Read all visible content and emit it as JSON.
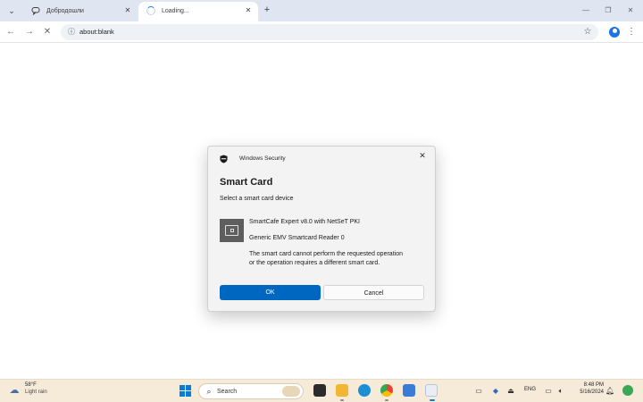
{
  "browser": {
    "tab_search_icon": "chevron-down-icon",
    "tabs": [
      {
        "title": "Добродошли",
        "icon": "chat-icon",
        "close_icon": "close-icon"
      },
      {
        "title": "Loading...",
        "icon": "spinner-icon",
        "close_icon": "close-icon"
      }
    ],
    "new_tab_icon": "plus-icon",
    "window_controls": [
      "minimize-icon",
      "restore-icon",
      "close-icon"
    ],
    "address": "about:blank",
    "nav_icons": [
      "back-icon",
      "forward-icon",
      "stop-icon"
    ]
  },
  "dialog": {
    "app_title": "Windows Security",
    "heading": "Smart Card",
    "subtitle": "Select a smart card device",
    "device_name": "SmartCafe Expert v8.0 with NetSeT PKI",
    "reader_name": "Generic EMV Smartcard Reader 0",
    "error_line1": "The smart card cannot perform the requested operation",
    "error_line2": "or the operation requires a different smart card.",
    "ok_label": "OK",
    "cancel_label": "Cancel",
    "accent_color": "#0067c0"
  },
  "taskbar": {
    "weather_temp": "58°F",
    "weather_condition": "Light rain",
    "search_label": "Search",
    "tray_lang": "ENG",
    "time": "8:48 PM",
    "date": "5/16/2024"
  }
}
